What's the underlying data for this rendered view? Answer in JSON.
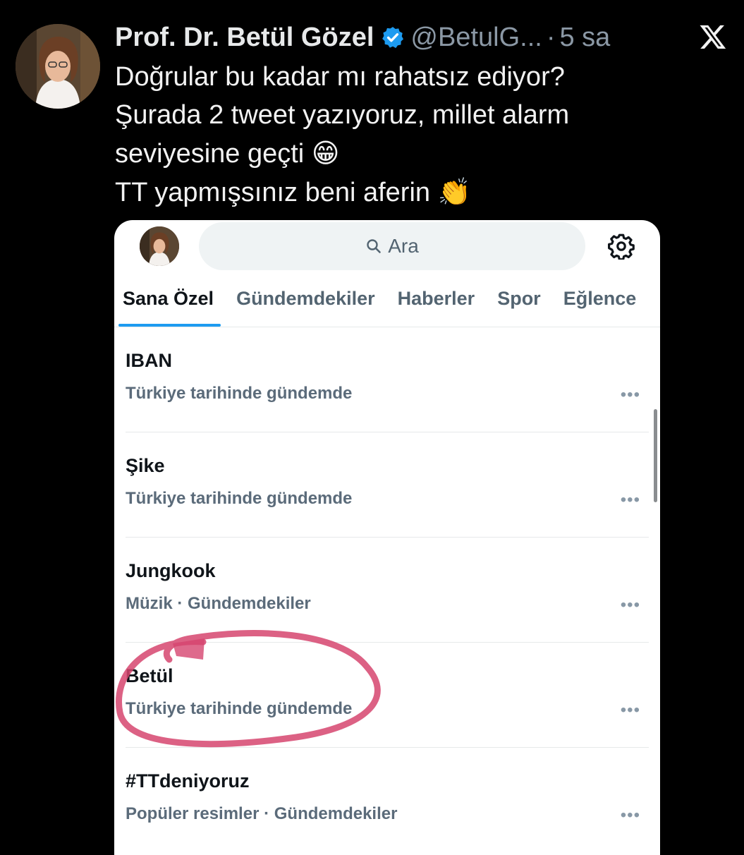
{
  "tweet": {
    "author_name": "Prof. Dr. Betül Gözel",
    "handle": "@BetulG...",
    "separator": "·",
    "time": "5 sa",
    "lines": [
      "Doğrular bu kadar mı rahatsız ediyor?",
      "Şurada 2 tweet yazıyoruz, millet alarm",
      "seviyesine geçti",
      "TT yapmışsınız beni aferin"
    ],
    "emoji_grin": "😁",
    "emoji_clap": "👏"
  },
  "explore": {
    "search_placeholder": "Ara",
    "tabs": [
      "Sana Özel",
      "Gündemdekiler",
      "Haberler",
      "Spor",
      "Eğlence"
    ],
    "trends": [
      {
        "title": "IBAN",
        "meta": "Türkiye tarihinde gündemde"
      },
      {
        "title": "Şike",
        "meta": "Türkiye tarihinde gündemde"
      },
      {
        "title": "Jungkook",
        "meta": "Müzik · Gündemdekiler"
      },
      {
        "title": "Betül",
        "meta": "Türkiye tarihinde gündemde"
      },
      {
        "title": "#TTdeniyoruz",
        "meta": "Popüler resimler · Gündemdekiler"
      }
    ],
    "more_label": "•••"
  },
  "colors": {
    "accent": "#1d9bf0",
    "verified": "#1d9bf0",
    "highlight_circle": "#d6456f"
  },
  "icons": [
    "verified-badge-icon",
    "x-logo-icon",
    "search-icon",
    "gear-icon",
    "more-icon"
  ]
}
